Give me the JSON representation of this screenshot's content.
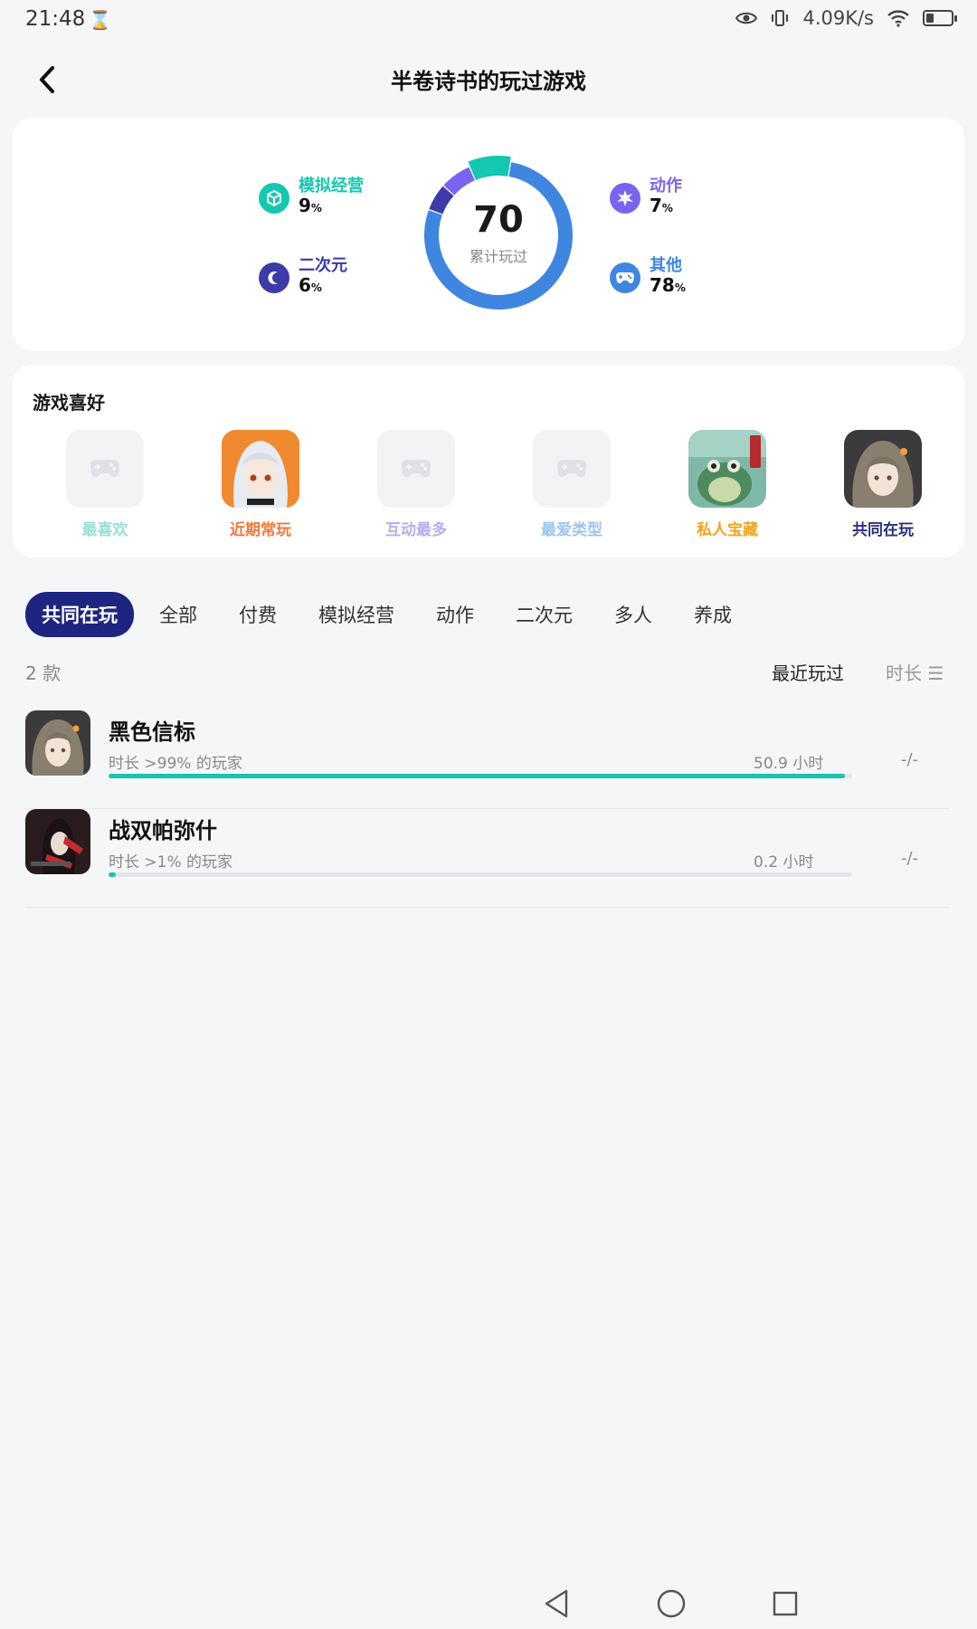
{
  "status_bar": {
    "time": "21:48",
    "network_speed": "4.09K/s",
    "icons": [
      "hourglass-icon",
      "eye-icon",
      "vibrate-icon",
      "wifi-icon",
      "battery-icon"
    ]
  },
  "header": {
    "title": "半卷诗书的玩过游戏",
    "back_icon": "chevron-left-icon"
  },
  "stats": {
    "total": "70",
    "total_label": "累计玩过",
    "categories": [
      {
        "label": "模拟经营",
        "pct": "9",
        "color": "#14c7b0",
        "icon": "cube-icon"
      },
      {
        "label": "二次元",
        "pct": "6",
        "color": "#3d3ba8",
        "icon": "crescent-icon"
      },
      {
        "label": "动作",
        "pct": "7",
        "color": "#7a63f0",
        "icon": "burst-icon"
      },
      {
        "label": "其他",
        "pct": "78",
        "color": "#3f86e0",
        "icon": "gamepad-icon"
      }
    ],
    "pct_unit": "%"
  },
  "preferences": {
    "title": "游戏喜好",
    "items": [
      {
        "label": "最喜欢",
        "color": "#9adfd6",
        "state": "empty"
      },
      {
        "label": "近期常玩",
        "color": "#f07a3a",
        "state": "filled"
      },
      {
        "label": "互动最多",
        "color": "#b6aef0",
        "state": "empty"
      },
      {
        "label": "最爱类型",
        "color": "#9fc4ee",
        "state": "empty"
      },
      {
        "label": "私人宝藏",
        "color": "#f0a520",
        "state": "filled"
      },
      {
        "label": "共同在玩",
        "color": "#2b2f7d",
        "state": "filled"
      }
    ]
  },
  "tabs": [
    "共同在玩",
    "全部",
    "付费",
    "模拟经营",
    "动作",
    "二次元",
    "多人",
    "养成"
  ],
  "list": {
    "count": "2 款",
    "sort_recent": "最近玩过",
    "sort_duration": "时长 ☰",
    "games": [
      {
        "name": "黑色信标",
        "sub": "时长 >99% 的玩家",
        "hours": "50.9 小时",
        "progress": 0.99,
        "rating": "-/-"
      },
      {
        "name": "战双帕弥什",
        "sub": "时长 >1% 的玩家",
        "hours": "0.2 小时",
        "progress": 0.01,
        "rating": "-/-"
      }
    ]
  },
  "nav": [
    "back-triangle-icon",
    "home-circle-icon",
    "recents-square-icon"
  ]
}
